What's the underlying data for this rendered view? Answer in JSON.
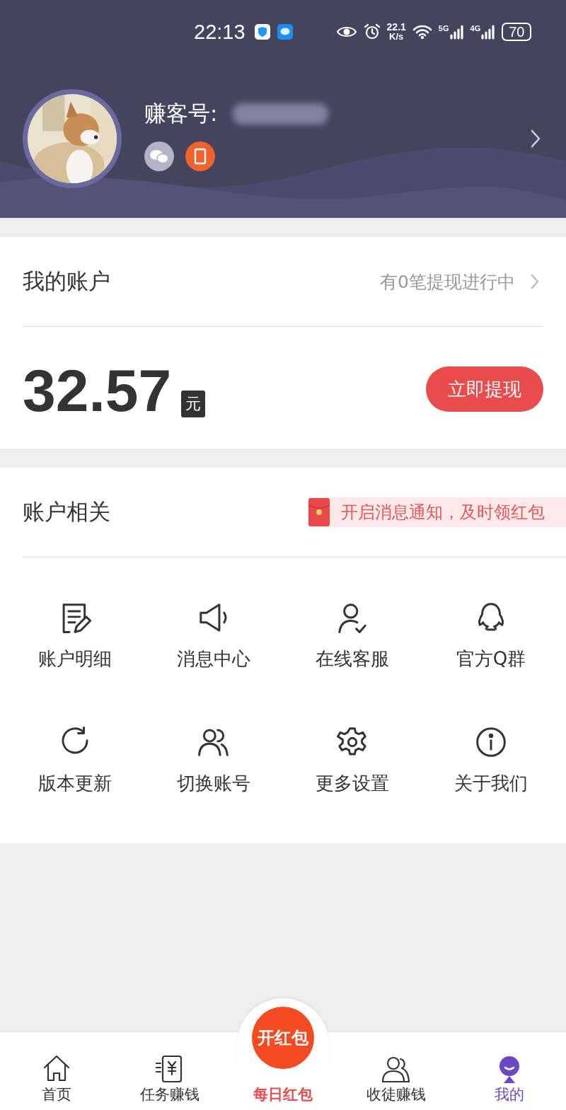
{
  "status_bar": {
    "time": "22:13",
    "speed_value": "22.1",
    "speed_unit": "K/s",
    "network_1": "5G",
    "network_2": "4G",
    "battery": "70"
  },
  "profile": {
    "id_label": "赚客号:"
  },
  "account": {
    "title": "我的账户",
    "withdraw_status": "有0笔提现进行中",
    "balance": "32.57",
    "unit": "元",
    "withdraw_button": "立即提现"
  },
  "related": {
    "title": "账户相关",
    "notice": "开启消息通知，及时领红包",
    "items": [
      {
        "label": "账户明细"
      },
      {
        "label": "消息中心"
      },
      {
        "label": "在线客服"
      },
      {
        "label": "官方Q群"
      },
      {
        "label": "版本更新"
      },
      {
        "label": "切换账号"
      },
      {
        "label": "更多设置"
      },
      {
        "label": "关于我们"
      }
    ]
  },
  "bottom_nav": [
    {
      "label": "首页",
      "kind": "tab",
      "selected": false
    },
    {
      "label": "任务赚钱",
      "kind": "tab",
      "selected": false
    },
    {
      "label": "每日红包",
      "kind": "center",
      "badge": "开红包",
      "selected": false
    },
    {
      "label": "收徒赚钱",
      "kind": "tab",
      "selected": false
    },
    {
      "label": "我的",
      "kind": "tab",
      "selected": true
    }
  ]
}
